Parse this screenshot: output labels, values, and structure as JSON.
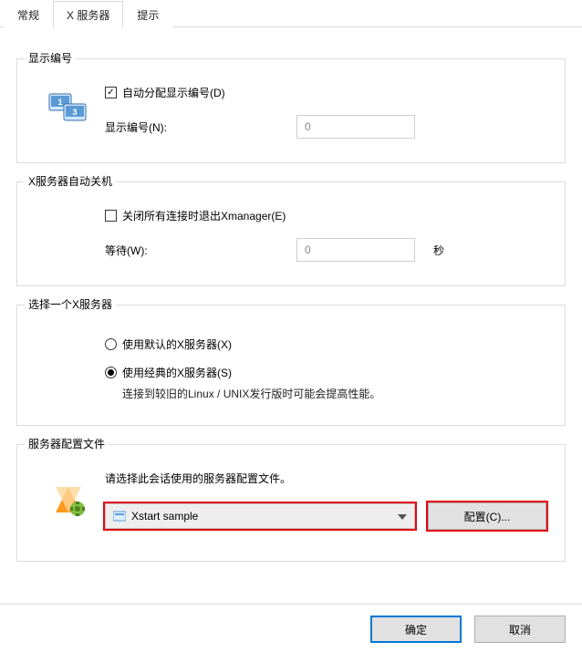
{
  "tabs": {
    "general": "常规",
    "xserver": "X 服务器",
    "tips": "提示",
    "active_index": 1
  },
  "group_display": {
    "title": "显示编号",
    "auto_assign_checked": true,
    "auto_assign_label": "自动分配显示编号(D)",
    "display_number_label": "显示编号(N):",
    "display_number_value": "0"
  },
  "group_shutdown": {
    "title": "X服务器自动关机",
    "exit_on_close_checked": false,
    "exit_on_close_label": "关闭所有连接时退出Xmanager(E)",
    "wait_label": "等待(W):",
    "wait_value": "0",
    "wait_unit": "秒"
  },
  "group_select": {
    "title": "选择一个X服务器",
    "option_default_label": "使用默认的X服务器(X)",
    "option_classic_label": "使用经典的X服务器(S)",
    "option_classic_hint": "连接到较旧的Linux / UNIX发行版时可能会提高性能。",
    "selected": "classic"
  },
  "group_profile": {
    "title": "服务器配置文件",
    "description": "请选择此会话使用的服务器配置文件。",
    "selected_profile": "Xstart sample",
    "configure_button": "配置(C)..."
  },
  "footer": {
    "ok": "确定",
    "cancel": "取消"
  }
}
